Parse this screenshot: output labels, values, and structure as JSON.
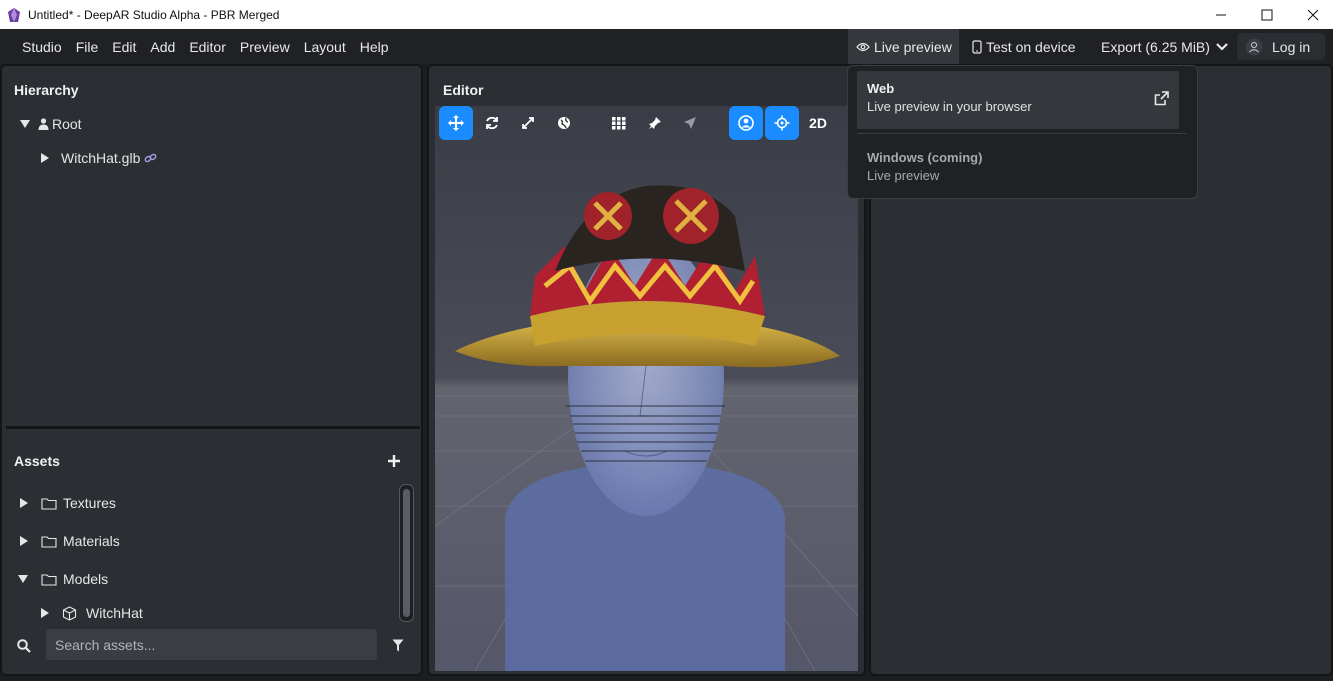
{
  "window": {
    "title": "Untitled* - DeepAR Studio Alpha - PBR Merged",
    "controls": [
      "minimize-icon",
      "maximize-icon",
      "close-icon"
    ]
  },
  "menubar": {
    "items": [
      "Studio",
      "File",
      "Edit",
      "Add",
      "Editor",
      "Preview",
      "Layout",
      "Help"
    ],
    "live_preview": "Live preview",
    "test_on_device": "Test on device",
    "export": "Export (6.25 MiB)",
    "login": "Log in"
  },
  "hierarchy": {
    "title": "Hierarchy",
    "root": "Root",
    "child": "WitchHat.glb"
  },
  "assets": {
    "title": "Assets",
    "folders": [
      "Textures",
      "Materials",
      "Models"
    ],
    "model_item": "WitchHat",
    "search_placeholder": "Search assets..."
  },
  "editor": {
    "title": "Editor",
    "tools": [
      "move-icon",
      "rotate-icon",
      "scale-icon",
      "globe-icon",
      "grid-icon",
      "pin-icon",
      "navigate-icon",
      "face-tracking-icon",
      "target-icon"
    ],
    "mode_2d": "2D"
  },
  "live_preview_menu": {
    "options": [
      {
        "title": "Web",
        "subtitle": "Live preview in your browser"
      },
      {
        "title": "Windows (coming)",
        "subtitle": "Live preview"
      }
    ]
  },
  "colors": {
    "accent": "#1a8cff",
    "panel": "#2b2e33",
    "background": "#1b1d20",
    "dropdown_highlight": "#34373b"
  }
}
